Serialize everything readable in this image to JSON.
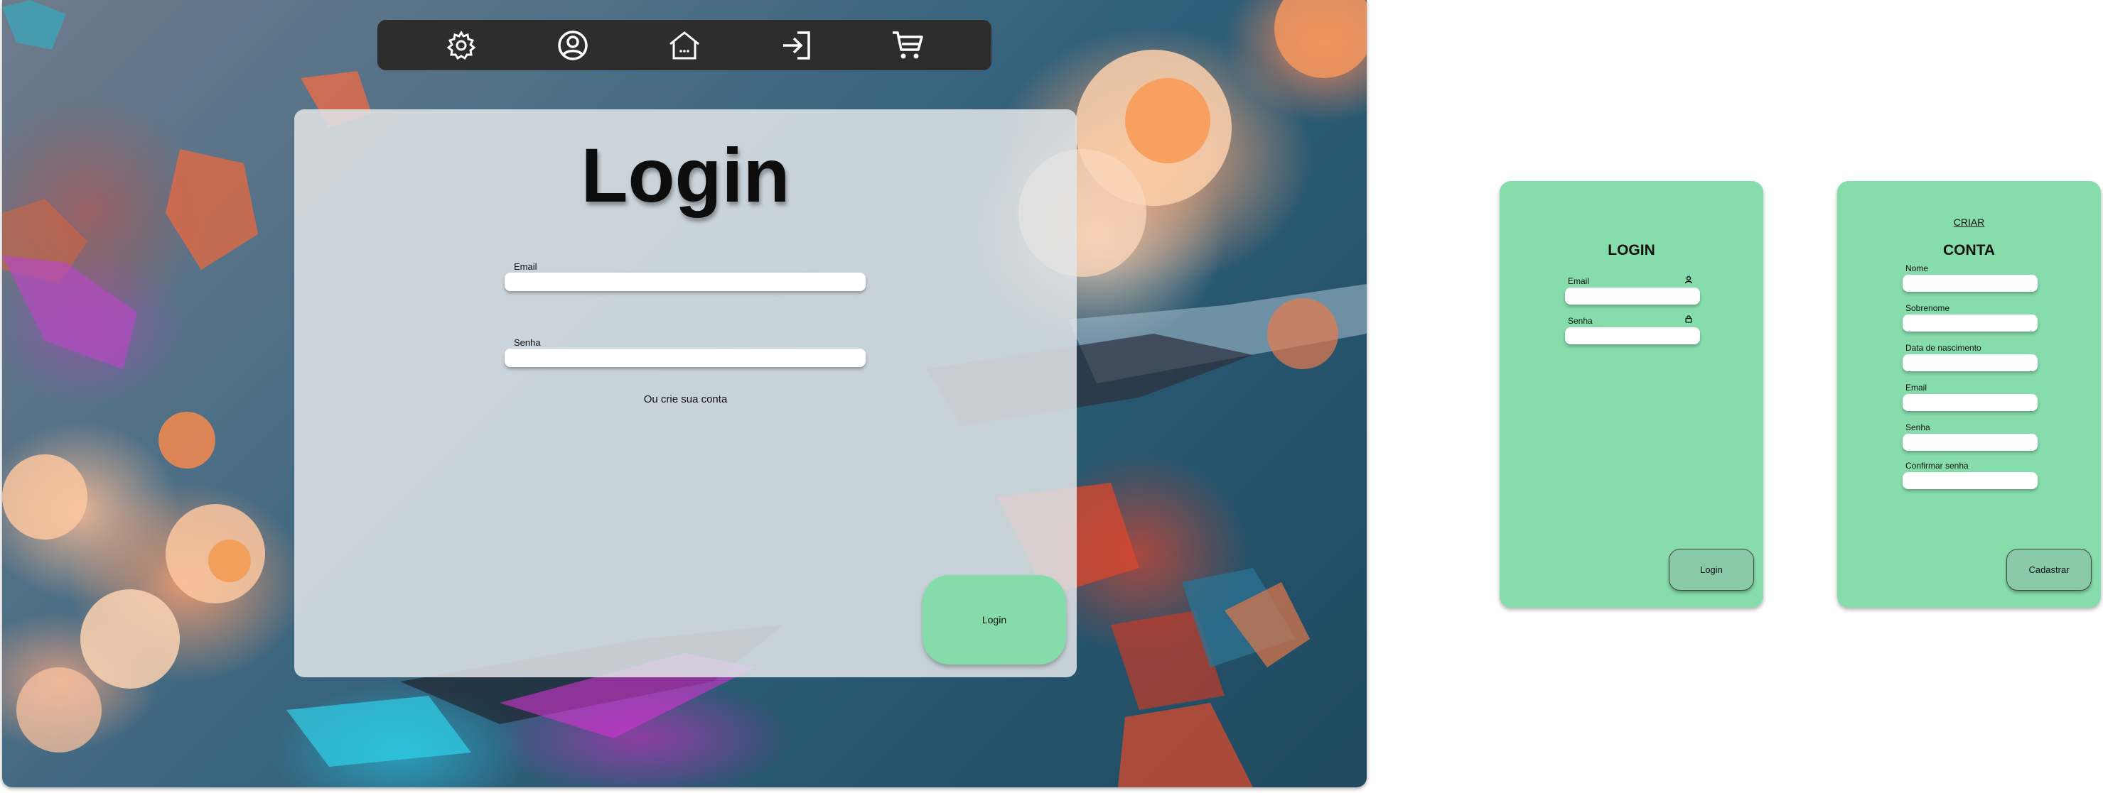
{
  "desktop": {
    "nav": {
      "items": [
        {
          "icon": "gear-icon"
        },
        {
          "icon": "user-circle-icon"
        },
        {
          "icon": "home-icon"
        },
        {
          "icon": "sign-in-icon"
        },
        {
          "icon": "cart-icon"
        }
      ]
    },
    "login": {
      "title": "Login",
      "email_label": "Email",
      "password_label": "Senha",
      "signup_link": "Ou crie sua conta",
      "submit_label": "Login"
    }
  },
  "mobile_login": {
    "title": "LOGIN",
    "email_label": "Email",
    "password_label": "Senha",
    "submit_label": "Login"
  },
  "mobile_signup": {
    "subtitle": "CRIAR",
    "title": "CONTA",
    "fields": [
      "Nome",
      "Sobrenome",
      "Data de nascimento",
      "Email",
      "Senha",
      "Confirmar senha"
    ],
    "submit_label": "Cadastrar"
  },
  "colors": {
    "accent_green": "#87dcac",
    "navbar": "#2d2d2d",
    "panel": "#e1e5e9"
  }
}
